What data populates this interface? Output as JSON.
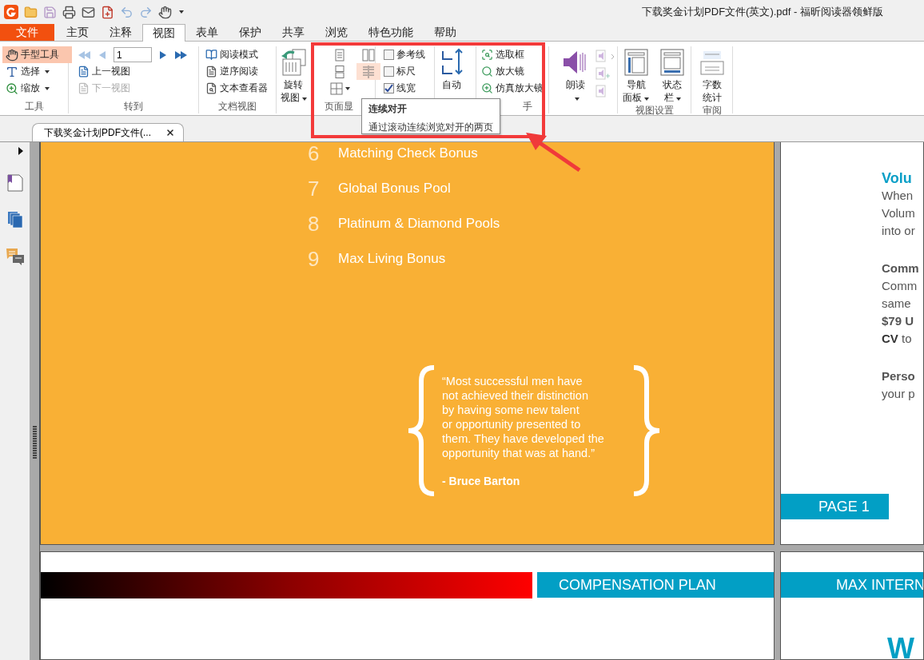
{
  "window": {
    "title": "下载奖金计划PDF文件(英文).pdf - 福昕阅读器领鲜版"
  },
  "menu_tabs": [
    {
      "label": "文件",
      "kind": "file",
      "selected": false
    },
    {
      "label": "主页",
      "kind": "tab",
      "selected": false
    },
    {
      "label": "注释",
      "kind": "tab",
      "selected": false
    },
    {
      "label": "视图",
      "kind": "tab",
      "selected": true
    },
    {
      "label": "表单",
      "kind": "tab",
      "selected": false
    },
    {
      "label": "保护",
      "kind": "tab",
      "selected": false
    },
    {
      "label": "共享",
      "kind": "tab",
      "selected": false
    },
    {
      "label": "浏览",
      "kind": "tab",
      "selected": false
    },
    {
      "label": "特色功能",
      "kind": "tab",
      "selected": false
    },
    {
      "label": "帮助",
      "kind": "tab",
      "selected": false
    }
  ],
  "tools_group": {
    "label": "工具",
    "items": [
      {
        "label": "手型工具",
        "kind": "hand",
        "selected": true,
        "dropdown": false
      },
      {
        "label": "选择",
        "kind": "select",
        "selected": false,
        "dropdown": true
      },
      {
        "label": "缩放",
        "kind": "zoom",
        "selected": false,
        "dropdown": true
      }
    ]
  },
  "goto_group": {
    "label": "转到",
    "page_value": "1",
    "items": [
      {
        "label": "上一视图",
        "disabled": false
      },
      {
        "label": "下一视图",
        "disabled": true
      }
    ]
  },
  "doc_view_group": {
    "label": "文档视图",
    "items": [
      {
        "label": "阅读模式",
        "kind": "book"
      },
      {
        "label": "逆序阅读",
        "kind": "reverse"
      },
      {
        "label": "文本查看器",
        "kind": "viewer"
      }
    ]
  },
  "rotate_button": {
    "lines": [
      "旋转",
      "视图"
    ]
  },
  "page_display_group": {
    "label": "页面显",
    "layouts": [
      {
        "kind": "single",
        "selected": false
      },
      {
        "kind": "facing",
        "selected": false
      },
      {
        "kind": "continuous",
        "selected": false
      },
      {
        "kind": "continuous_facing",
        "selected": true
      },
      {
        "kind": "split",
        "selected": false
      }
    ],
    "checkboxes": [
      {
        "label": "参考线",
        "checked": false
      },
      {
        "label": "标尺",
        "checked": false
      },
      {
        "label": "线宽",
        "checked": true
      }
    ]
  },
  "auto_scroll_button": {
    "label": "自动"
  },
  "assistant_group": {
    "label": "手",
    "items": [
      {
        "label": "选取框",
        "kind": "marquee"
      },
      {
        "label": "放大镜",
        "kind": "loupe"
      },
      {
        "label": "仿真放大镜",
        "kind": "magnifier"
      }
    ]
  },
  "read_aloud_button": {
    "label": "朗读"
  },
  "view_settings_group": {
    "label": "视图设置",
    "items": [
      {
        "kind": "nav",
        "lines": [
          "导航",
          "面板"
        ]
      },
      {
        "kind": "status",
        "lines": [
          "状态",
          "栏"
        ]
      }
    ]
  },
  "review_group": {
    "label": "审阅",
    "items": [
      {
        "lines": [
          "字数",
          "统计"
        ]
      }
    ]
  },
  "tooltip": {
    "title": "连续对开",
    "text": "通过滚动连续浏览对开的两页"
  },
  "doc_tabs": [
    {
      "label": "下载奖金计划PDF文件(...",
      "selected": true
    }
  ],
  "cover_page": {
    "list": [
      {
        "number": "6",
        "label": "Matching Check Bonus"
      },
      {
        "number": "7",
        "label": "Global Bonus Pool"
      },
      {
        "number": "8",
        "label": "Platinum & Diamond Pools"
      },
      {
        "number": "9",
        "label": "Max Living Bonus"
      }
    ],
    "quote": {
      "lines": [
        "“Most successful men have",
        "not achieved their distinction",
        "by having some new talent",
        "or opportunity presented to",
        "them. They have developed the",
        "opportunity that was at hand.”"
      ],
      "author": "- Bruce Barton"
    }
  },
  "right_page": {
    "blocks": [
      {
        "kind": "heading",
        "text": "Volu"
      },
      {
        "kind": "line",
        "text": "When"
      },
      {
        "kind": "line",
        "text": "Volum"
      },
      {
        "kind": "line",
        "text": "into or"
      },
      {
        "kind": "subheading",
        "text": "Comm"
      },
      {
        "kind": "line",
        "text": "Comm"
      },
      {
        "kind": "line",
        "text": "same"
      },
      {
        "kind": "bold_line",
        "text": "$79 U"
      },
      {
        "kind": "line",
        "text": "**CV** to"
      },
      {
        "kind": "subheading",
        "text": "Perso"
      },
      {
        "kind": "line",
        "text": "your p"
      }
    ],
    "page_band": "PAGE **1**"
  },
  "bottom_left_page": {
    "band": "COMPENSATION **PLAN**"
  },
  "bottom_right_page": {
    "band": "**MAX** INTERN",
    "heading": "W"
  }
}
